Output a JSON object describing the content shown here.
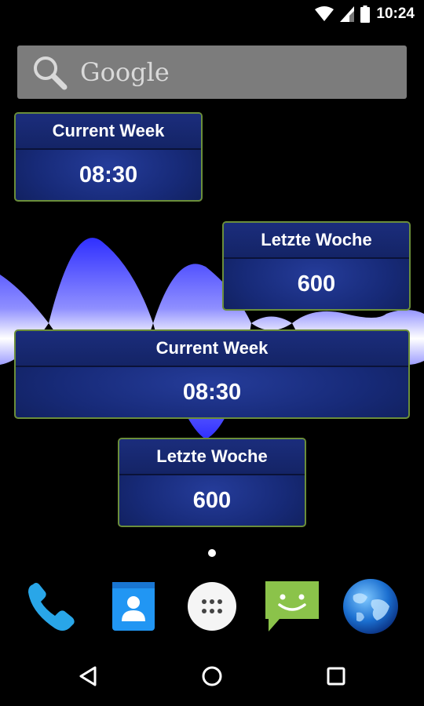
{
  "status_bar": {
    "time": "10:24",
    "icons": [
      "wifi-icon",
      "signal-icon",
      "battery-icon"
    ]
  },
  "search": {
    "label": "Google",
    "icon": "search-icon"
  },
  "widgets": [
    {
      "title": "Current Week",
      "value": "08:30"
    },
    {
      "title": "Letzte Woche",
      "value": "600"
    },
    {
      "title": "Current Week",
      "value": "08:30"
    },
    {
      "title": "Letzte Woche",
      "value": "600"
    }
  ],
  "dock": {
    "apps": [
      "phone-icon",
      "contacts-icon",
      "app-drawer-icon",
      "messaging-icon",
      "browser-globe-icon"
    ]
  },
  "nav": {
    "buttons": [
      "back-icon",
      "home-icon",
      "recents-icon"
    ]
  },
  "colors": {
    "widget_border": "#6b8e3a",
    "widget_blue": "#172a78",
    "wave_blue": "#3b3bff"
  }
}
